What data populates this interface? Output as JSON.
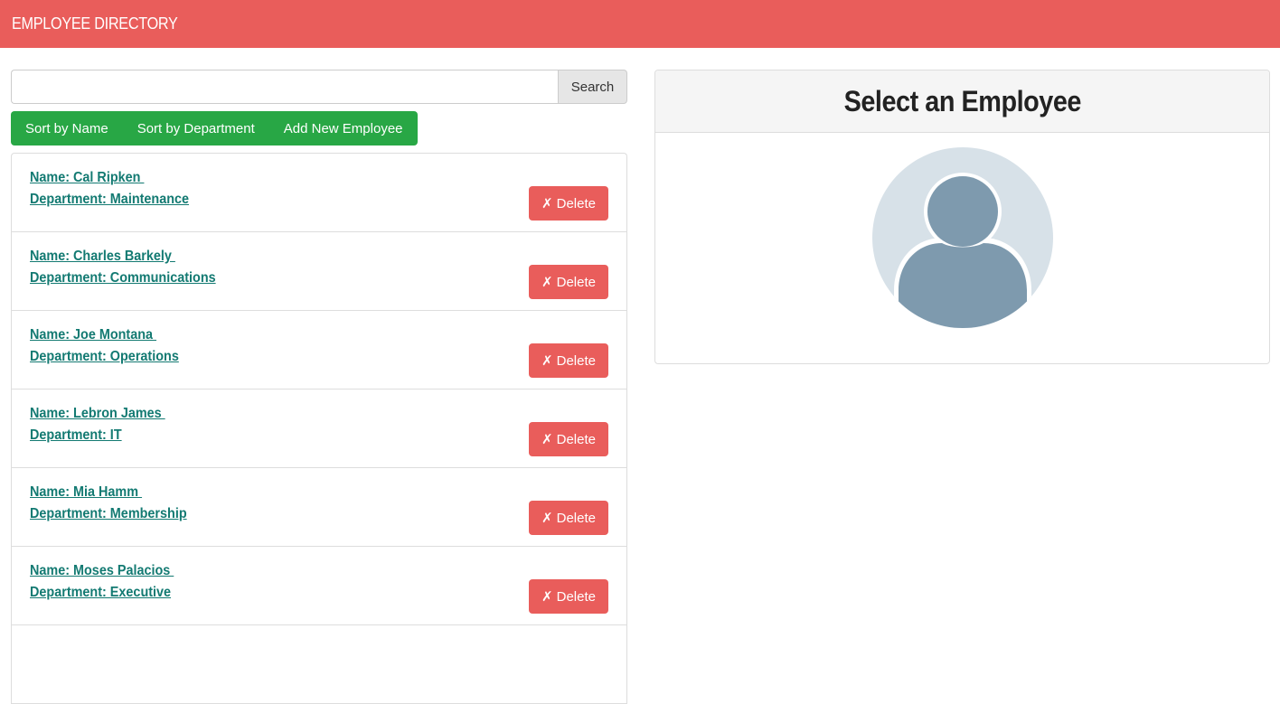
{
  "header": {
    "title": "EMPLOYEE DIRECTORY"
  },
  "search": {
    "value": "",
    "placeholder": "",
    "button_label": "Search"
  },
  "actions": {
    "sort_name": "Sort by Name",
    "sort_department": "Sort by Department",
    "add_new": "Add New Employee"
  },
  "employees": [
    {
      "name": "Name: Cal Ripken ",
      "department": "Department: Maintenance",
      "delete_label": "Delete"
    },
    {
      "name": "Name: Charles Barkely ",
      "department": "Department: Communications",
      "delete_label": "Delete"
    },
    {
      "name": "Name: Joe Montana ",
      "department": "Department: Operations",
      "delete_label": "Delete"
    },
    {
      "name": "Name: Lebron James ",
      "department": "Department: IT",
      "delete_label": "Delete"
    },
    {
      "name": "Name: Mia Hamm ",
      "department": "Department: Membership",
      "delete_label": "Delete"
    },
    {
      "name": "Name: Moses Palacios ",
      "department": "Department: Executive",
      "delete_label": "Delete"
    }
  ],
  "detail": {
    "title": "Select an Employee",
    "avatar_icon": "user-placeholder-icon"
  },
  "colors": {
    "navbar": "#e95d5b",
    "green": "#28a745",
    "link": "#137a72",
    "delete": "#e95d5b"
  }
}
